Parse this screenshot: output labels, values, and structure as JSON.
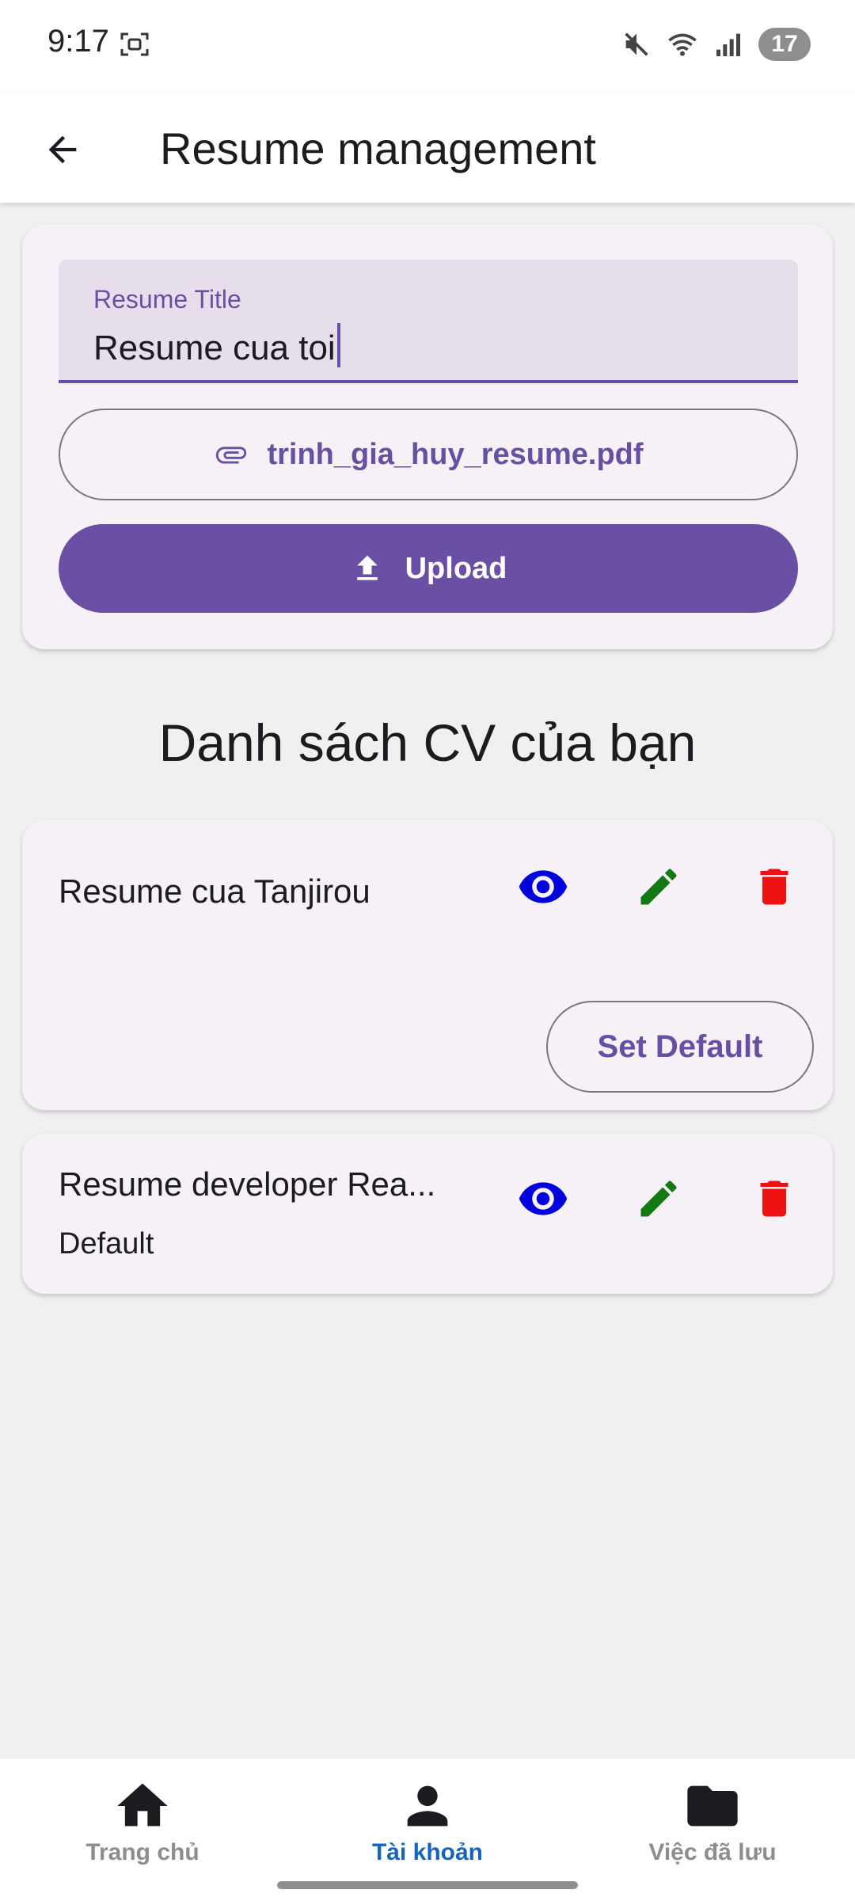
{
  "status_bar": {
    "time": "9:17",
    "battery": "17",
    "icons": [
      "screenshot-icon",
      "mute-icon",
      "wifi-icon",
      "signal-icon"
    ]
  },
  "app_bar": {
    "title": "Resume management",
    "back_icon": "arrow-back-icon"
  },
  "form": {
    "title_field": {
      "label": "Resume Title",
      "value": "Resume cua toi"
    },
    "file_button": {
      "icon": "attachment-icon",
      "label": "trinh_gia_huy_resume.pdf"
    },
    "upload_button": {
      "icon": "upload-icon",
      "label": "Upload"
    }
  },
  "resume_list": {
    "heading": "Danh sách CV của bạn",
    "items": [
      {
        "title": "Resume cua Tanjirou",
        "subtitle": "",
        "set_default_label": "Set Default"
      },
      {
        "title": "Resume developer Rea...",
        "subtitle": "Default",
        "set_default_label": ""
      }
    ],
    "actions": {
      "view_icon": "eye-icon",
      "edit_icon": "pencil-icon",
      "delete_icon": "trash-icon",
      "view_color": "#0000dd",
      "edit_color": "#137a13",
      "delete_color": "#ee1111"
    }
  },
  "bottom_nav": {
    "items": [
      {
        "label": "Trang chủ",
        "icon": "home-icon",
        "active": false
      },
      {
        "label": "Tài khoản",
        "icon": "person-icon",
        "active": true
      },
      {
        "label": "Việc đã lưu",
        "icon": "folder-icon",
        "active": false
      }
    ],
    "active_color": "#1565c0"
  },
  "theme": {
    "primary": "#6a50a4",
    "surface": "#f5f1f7",
    "background": "#f1f0f1"
  }
}
